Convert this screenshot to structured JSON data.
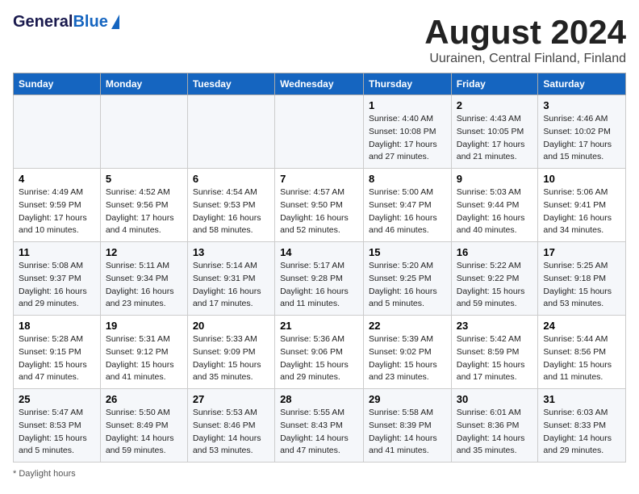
{
  "header": {
    "logo_general": "General",
    "logo_blue": "Blue",
    "title": "August 2024",
    "subtitle": "Uurainen, Central Finland, Finland"
  },
  "columns": [
    "Sunday",
    "Monday",
    "Tuesday",
    "Wednesday",
    "Thursday",
    "Friday",
    "Saturday"
  ],
  "rows": [
    [
      {
        "day": "",
        "info": ""
      },
      {
        "day": "",
        "info": ""
      },
      {
        "day": "",
        "info": ""
      },
      {
        "day": "",
        "info": ""
      },
      {
        "day": "1",
        "info": "Sunrise: 4:40 AM\nSunset: 10:08 PM\nDaylight: 17 hours\nand 27 minutes."
      },
      {
        "day": "2",
        "info": "Sunrise: 4:43 AM\nSunset: 10:05 PM\nDaylight: 17 hours\nand 21 minutes."
      },
      {
        "day": "3",
        "info": "Sunrise: 4:46 AM\nSunset: 10:02 PM\nDaylight: 17 hours\nand 15 minutes."
      }
    ],
    [
      {
        "day": "4",
        "info": "Sunrise: 4:49 AM\nSunset: 9:59 PM\nDaylight: 17 hours\nand 10 minutes."
      },
      {
        "day": "5",
        "info": "Sunrise: 4:52 AM\nSunset: 9:56 PM\nDaylight: 17 hours\nand 4 minutes."
      },
      {
        "day": "6",
        "info": "Sunrise: 4:54 AM\nSunset: 9:53 PM\nDaylight: 16 hours\nand 58 minutes."
      },
      {
        "day": "7",
        "info": "Sunrise: 4:57 AM\nSunset: 9:50 PM\nDaylight: 16 hours\nand 52 minutes."
      },
      {
        "day": "8",
        "info": "Sunrise: 5:00 AM\nSunset: 9:47 PM\nDaylight: 16 hours\nand 46 minutes."
      },
      {
        "day": "9",
        "info": "Sunrise: 5:03 AM\nSunset: 9:44 PM\nDaylight: 16 hours\nand 40 minutes."
      },
      {
        "day": "10",
        "info": "Sunrise: 5:06 AM\nSunset: 9:41 PM\nDaylight: 16 hours\nand 34 minutes."
      }
    ],
    [
      {
        "day": "11",
        "info": "Sunrise: 5:08 AM\nSunset: 9:37 PM\nDaylight: 16 hours\nand 29 minutes."
      },
      {
        "day": "12",
        "info": "Sunrise: 5:11 AM\nSunset: 9:34 PM\nDaylight: 16 hours\nand 23 minutes."
      },
      {
        "day": "13",
        "info": "Sunrise: 5:14 AM\nSunset: 9:31 PM\nDaylight: 16 hours\nand 17 minutes."
      },
      {
        "day": "14",
        "info": "Sunrise: 5:17 AM\nSunset: 9:28 PM\nDaylight: 16 hours\nand 11 minutes."
      },
      {
        "day": "15",
        "info": "Sunrise: 5:20 AM\nSunset: 9:25 PM\nDaylight: 16 hours\nand 5 minutes."
      },
      {
        "day": "16",
        "info": "Sunrise: 5:22 AM\nSunset: 9:22 PM\nDaylight: 15 hours\nand 59 minutes."
      },
      {
        "day": "17",
        "info": "Sunrise: 5:25 AM\nSunset: 9:18 PM\nDaylight: 15 hours\nand 53 minutes."
      }
    ],
    [
      {
        "day": "18",
        "info": "Sunrise: 5:28 AM\nSunset: 9:15 PM\nDaylight: 15 hours\nand 47 minutes."
      },
      {
        "day": "19",
        "info": "Sunrise: 5:31 AM\nSunset: 9:12 PM\nDaylight: 15 hours\nand 41 minutes."
      },
      {
        "day": "20",
        "info": "Sunrise: 5:33 AM\nSunset: 9:09 PM\nDaylight: 15 hours\nand 35 minutes."
      },
      {
        "day": "21",
        "info": "Sunrise: 5:36 AM\nSunset: 9:06 PM\nDaylight: 15 hours\nand 29 minutes."
      },
      {
        "day": "22",
        "info": "Sunrise: 5:39 AM\nSunset: 9:02 PM\nDaylight: 15 hours\nand 23 minutes."
      },
      {
        "day": "23",
        "info": "Sunrise: 5:42 AM\nSunset: 8:59 PM\nDaylight: 15 hours\nand 17 minutes."
      },
      {
        "day": "24",
        "info": "Sunrise: 5:44 AM\nSunset: 8:56 PM\nDaylight: 15 hours\nand 11 minutes."
      }
    ],
    [
      {
        "day": "25",
        "info": "Sunrise: 5:47 AM\nSunset: 8:53 PM\nDaylight: 15 hours\nand 5 minutes."
      },
      {
        "day": "26",
        "info": "Sunrise: 5:50 AM\nSunset: 8:49 PM\nDaylight: 14 hours\nand 59 minutes."
      },
      {
        "day": "27",
        "info": "Sunrise: 5:53 AM\nSunset: 8:46 PM\nDaylight: 14 hours\nand 53 minutes."
      },
      {
        "day": "28",
        "info": "Sunrise: 5:55 AM\nSunset: 8:43 PM\nDaylight: 14 hours\nand 47 minutes."
      },
      {
        "day": "29",
        "info": "Sunrise: 5:58 AM\nSunset: 8:39 PM\nDaylight: 14 hours\nand 41 minutes."
      },
      {
        "day": "30",
        "info": "Sunrise: 6:01 AM\nSunset: 8:36 PM\nDaylight: 14 hours\nand 35 minutes."
      },
      {
        "day": "31",
        "info": "Sunrise: 6:03 AM\nSunset: 8:33 PM\nDaylight: 14 hours\nand 29 minutes."
      }
    ]
  ],
  "footer": {
    "daylight_label": "Daylight hours"
  }
}
